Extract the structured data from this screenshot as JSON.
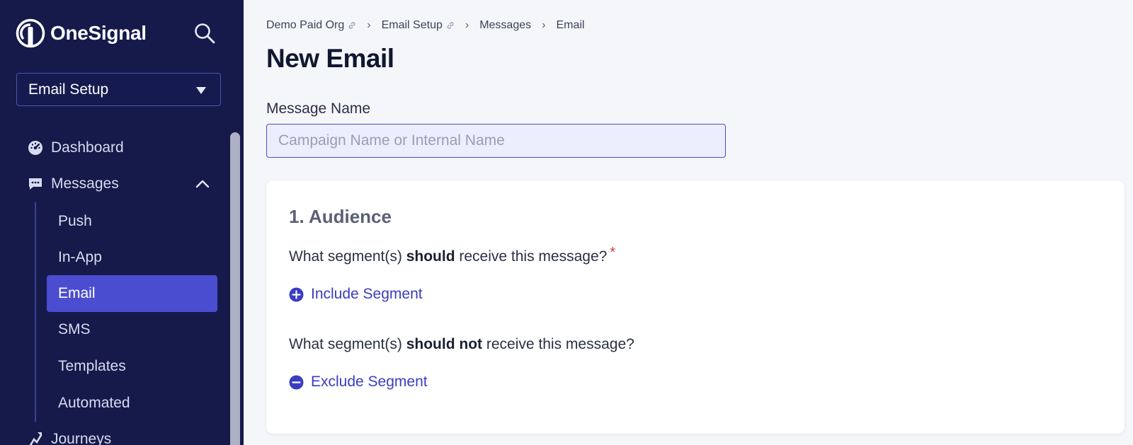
{
  "brand": {
    "name": "OneSignal"
  },
  "sidebar": {
    "app_selector": {
      "value": "Email Setup"
    },
    "nav": [
      {
        "label": "Dashboard",
        "icon": "dashboard-gauge-icon"
      },
      {
        "label": "Messages",
        "icon": "chat-bubble-icon",
        "expanded": true
      },
      {
        "label": "Journeys",
        "icon": "journeys-icon"
      }
    ],
    "messages_sub": [
      "Push",
      "In-App",
      "Email",
      "SMS",
      "Templates",
      "Automated"
    ],
    "active_sub": "Email"
  },
  "breadcrumb": [
    "Demo Paid Org",
    "Email Setup",
    "Messages",
    "Email"
  ],
  "page": {
    "title": "New Email"
  },
  "message_name": {
    "label": "Message Name",
    "placeholder": "Campaign Name or Internal Name",
    "value": ""
  },
  "audience": {
    "title": "1. Audience",
    "include_question": {
      "prefix": "What segment(s) ",
      "bold": "should",
      "suffix": " receive this message?",
      "required_mark": "*"
    },
    "include_button": "Include Segment",
    "exclude_question": {
      "prefix": "What segment(s) ",
      "bold": "should not",
      "suffix": " receive this message?"
    },
    "exclude_button": "Exclude Segment"
  },
  "colors": {
    "sidebar_bg": "#151a4a",
    "accent": "#4a4dd0",
    "link": "#3a3dc2",
    "required": "#d43f3a"
  }
}
